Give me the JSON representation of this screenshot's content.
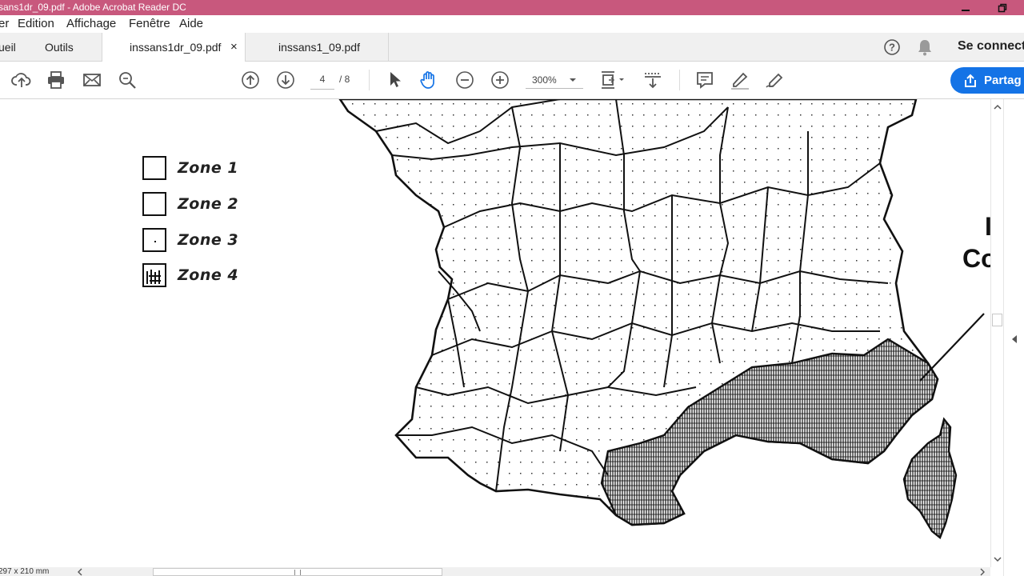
{
  "window": {
    "title": "sans1dr_09.pdf - Adobe Acrobat Reader DC"
  },
  "menu": {
    "items": [
      "er",
      "Edition",
      "Affichage",
      "Fenêtre",
      "Aide"
    ]
  },
  "tabs": {
    "home": "ueil",
    "tools": "Outils",
    "doc1": "inssans1dr_09.pdf",
    "doc1_close": "×",
    "doc2": "inssans1_09.pdf",
    "sign_in": "Se connect"
  },
  "toolbar": {
    "page_current": "4",
    "page_total": "/ 8",
    "zoom": "300%",
    "share_label": "Partag"
  },
  "document": {
    "legend": [
      {
        "label": "Zone 1",
        "pattern": "empty"
      },
      {
        "label": "Zone 2",
        "pattern": "empty"
      },
      {
        "label": "Zone 3",
        "pattern": "dot"
      },
      {
        "label": "Zone 4",
        "pattern": "hatched"
      }
    ],
    "right_text_1": "I",
    "right_text_2": "Co"
  },
  "status": {
    "page_size": "297 x 210 mm"
  },
  "colors": {
    "titlebar": "#c8587d",
    "accent": "#1473e6"
  }
}
